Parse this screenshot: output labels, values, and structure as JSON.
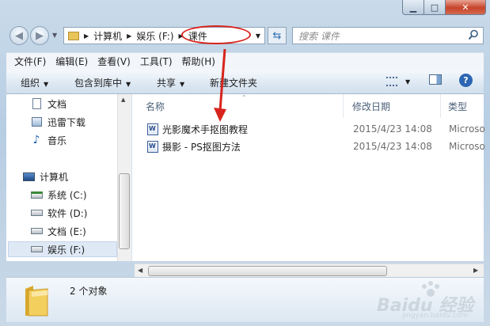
{
  "address": {
    "crumbs": [
      "计算机",
      "娱乐 (F:)",
      "课件"
    ]
  },
  "search": {
    "placeholder": "搜索 课件"
  },
  "menu": [
    "文件(F)",
    "编辑(E)",
    "查看(V)",
    "工具(T)",
    "帮助(H)"
  ],
  "toolbar": {
    "organize": "组织",
    "include_library": "包含到库中",
    "share": "共享",
    "new_folder": "新建文件夹"
  },
  "nav": {
    "favorites": [
      {
        "label": "文档",
        "icon": "document-icon"
      },
      {
        "label": "迅雷下载",
        "icon": "download-icon"
      },
      {
        "label": "音乐",
        "icon": "music-icon"
      }
    ],
    "computer": "计算机",
    "drives": [
      {
        "label": "系统 (C:)",
        "icon": "system-drive-icon"
      },
      {
        "label": "软件 (D:)",
        "icon": "drive-icon"
      },
      {
        "label": "文档 (E:)",
        "icon": "drive-icon"
      },
      {
        "label": "娱乐 (F:)",
        "icon": "drive-icon"
      }
    ]
  },
  "columns": {
    "name": "名称",
    "date": "修改日期",
    "type": "类型"
  },
  "files": [
    {
      "name": "光影魔术手抠图教程",
      "date": "2015/4/23 14:08",
      "type": "Microso"
    },
    {
      "name": "摄影 - PS抠图方法",
      "date": "2015/4/23 14:08",
      "type": "Microso"
    }
  ],
  "details": {
    "count": "2 个对象"
  },
  "watermark": {
    "text": "Baidu 经验",
    "sub": "jingyan.baidu.com"
  },
  "colors": {
    "annotation": "#d8241c",
    "accent": "#2f6fb0"
  }
}
